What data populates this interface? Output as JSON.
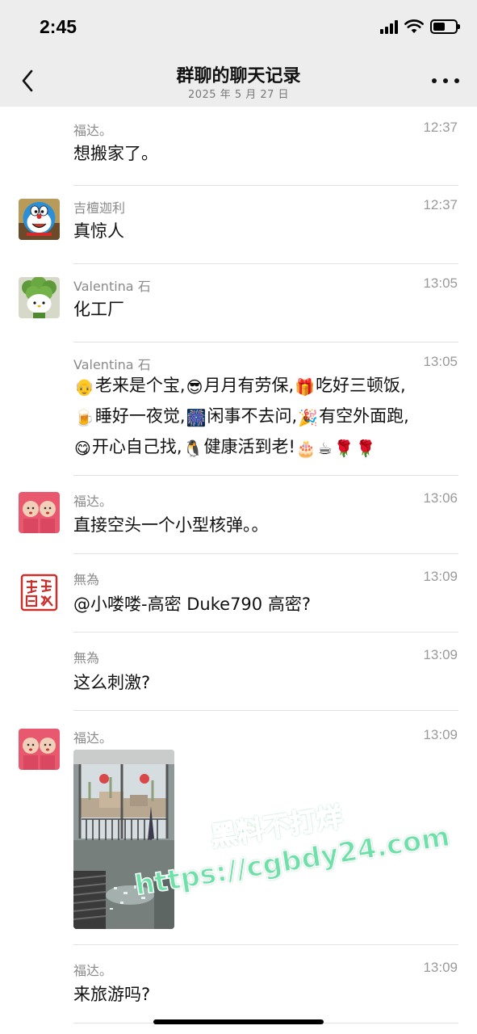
{
  "status_bar": {
    "time": "2:45"
  },
  "nav": {
    "title": "群聊的聊天记录",
    "date": "2025 年 5 月 27 日"
  },
  "messages": [
    {
      "sender": "福达。",
      "time": "12:37",
      "text": "想搬家了。"
    },
    {
      "sender": "吉檀迦利",
      "time": "12:37",
      "text": "真惊人"
    },
    {
      "sender": "Valentina 石",
      "time": "13:05",
      "text": "化工厂"
    },
    {
      "sender": "Valentina 石",
      "time": "13:05",
      "lines": [
        [
          "[老人表情]",
          "老来是个宝,",
          "[墨镜表情]",
          "月月有劳保,",
          "[礼物表情]",
          "吃好三顿饭,"
        ],
        [
          "[啤酒表情]",
          "睡好一夜觉,",
          "[烟花表情]",
          "闲事不去问,",
          "[庆祝表情]",
          "有空外面跑,"
        ],
        [
          "[666表情]",
          "开心自己找,",
          "[企鹅表情]",
          "健康活到老!",
          "[蛋糕表情]",
          "[咖啡表情]",
          "[玫瑰表情]",
          "[玫瑰表情]"
        ]
      ],
      "emoji": {
        "[老人表情]": "👴",
        "[墨镜表情]": "😎",
        "[礼物表情]": "🎁",
        "[啤酒表情]": "🍺",
        "[烟花表情]": "🎆",
        "[庆祝表情]": "🎉",
        "[666表情]": "😋",
        "[企鹅表情]": "🐧",
        "[蛋糕表情]": "🎂",
        "[咖啡表情]": "☕",
        "[玫瑰表情]": "🌹"
      }
    },
    {
      "sender": "福达。",
      "time": "13:06",
      "text": "直接空头一个小型核弹。。"
    },
    {
      "sender": "無為",
      "time": "13:09",
      "text": "@小喽喽-高密 Duke790 高密?"
    },
    {
      "sender": "無為",
      "time": "13:09",
      "text": "这么刺激?"
    },
    {
      "sender": "福达。",
      "time": "13:09",
      "image": "room-photo"
    },
    {
      "sender": "福达。",
      "time": "13:09",
      "text": "来旅游吗?"
    }
  ],
  "watermark": {
    "line1": "黑料不打烊",
    "line2": "https://cgbdy24.com"
  }
}
